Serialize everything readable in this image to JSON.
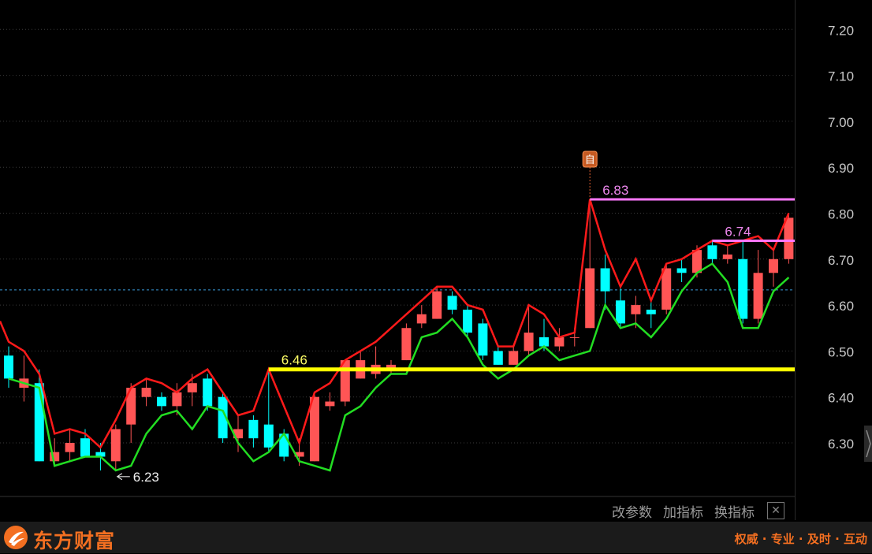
{
  "chart_data": {
    "type": "candlestick",
    "y_ticks": [
      "7.20",
      "7.10",
      "7.00",
      "6.90",
      "6.80",
      "6.70",
      "6.60",
      "6.50",
      "6.40",
      "6.30"
    ],
    "ylim": [
      6.175,
      7.255
    ],
    "grid": true,
    "last_price": 6.633,
    "candles": [
      [
        6.49,
        6.44,
        6.51,
        6.42
      ],
      [
        6.42,
        6.44,
        6.49,
        6.39
      ],
      [
        6.43,
        6.26,
        6.46,
        6.26
      ],
      [
        6.26,
        6.28,
        6.31,
        6.25
      ],
      [
        6.28,
        6.3,
        6.33,
        6.26
      ],
      [
        6.31,
        6.27,
        6.33,
        6.27
      ],
      [
        6.28,
        6.27,
        6.3,
        6.24
      ],
      [
        6.26,
        6.33,
        6.34,
        6.24
      ],
      [
        6.34,
        6.42,
        6.43,
        6.3
      ],
      [
        6.4,
        6.42,
        6.44,
        6.38
      ],
      [
        6.4,
        6.38,
        6.41,
        6.37
      ],
      [
        6.38,
        6.41,
        6.43,
        6.36
      ],
      [
        6.41,
        6.43,
        6.45,
        6.38
      ],
      [
        6.44,
        6.38,
        6.45,
        6.37
      ],
      [
        6.4,
        6.31,
        6.41,
        6.3
      ],
      [
        6.31,
        6.33,
        6.36,
        6.28
      ],
      [
        6.35,
        6.31,
        6.36,
        6.29
      ],
      [
        6.34,
        6.29,
        6.46,
        6.28
      ],
      [
        6.32,
        6.27,
        6.33,
        6.26
      ],
      [
        6.27,
        6.28,
        6.31,
        6.25
      ],
      [
        6.26,
        6.4,
        6.41,
        6.26
      ],
      [
        6.38,
        6.39,
        6.41,
        6.37
      ],
      [
        6.39,
        6.48,
        6.48,
        6.38
      ],
      [
        6.44,
        6.48,
        6.5,
        6.44
      ],
      [
        6.45,
        6.47,
        6.51,
        6.44
      ],
      [
        6.46,
        6.47,
        6.48,
        6.45
      ],
      [
        6.48,
        6.55,
        6.56,
        6.48
      ],
      [
        6.56,
        6.58,
        6.6,
        6.55
      ],
      [
        6.57,
        6.63,
        6.64,
        6.57
      ],
      [
        6.62,
        6.59,
        6.63,
        6.58
      ],
      [
        6.59,
        6.54,
        6.6,
        6.53
      ],
      [
        6.56,
        6.49,
        6.57,
        6.48
      ],
      [
        6.5,
        6.47,
        6.51,
        6.47
      ],
      [
        6.47,
        6.5,
        6.51,
        6.47
      ],
      [
        6.5,
        6.54,
        6.6,
        6.49
      ],
      [
        6.53,
        6.51,
        6.57,
        6.5
      ],
      [
        6.51,
        6.53,
        6.55,
        6.5
      ],
      [
        6.53,
        6.53,
        6.55,
        6.51
      ],
      [
        6.55,
        6.68,
        6.83,
        6.55
      ],
      [
        6.68,
        6.63,
        6.71,
        6.59
      ],
      [
        6.61,
        6.56,
        6.64,
        6.55
      ],
      [
        6.58,
        6.6,
        6.62,
        6.55
      ],
      [
        6.59,
        6.58,
        6.61,
        6.55
      ],
      [
        6.59,
        6.68,
        6.69,
        6.58
      ],
      [
        6.68,
        6.67,
        6.7,
        6.65
      ],
      [
        6.67,
        6.72,
        6.73,
        6.66
      ],
      [
        6.73,
        6.7,
        6.74,
        6.69
      ],
      [
        6.7,
        6.71,
        6.73,
        6.69
      ],
      [
        6.7,
        6.57,
        6.74,
        6.56
      ],
      [
        6.57,
        6.67,
        6.72,
        6.56
      ],
      [
        6.67,
        6.7,
        6.72,
        6.64
      ],
      [
        6.7,
        6.79,
        6.8,
        6.69
      ]
    ],
    "upper_band": [
      6.52,
      6.5,
      6.45,
      6.32,
      6.33,
      6.32,
      6.29,
      6.35,
      6.42,
      6.44,
      6.43,
      6.41,
      6.44,
      6.46,
      6.41,
      6.36,
      6.37,
      6.46,
      6.38,
      6.3,
      6.41,
      6.43,
      6.48,
      6.5,
      6.52,
      6.55,
      6.58,
      6.61,
      6.64,
      6.64,
      6.6,
      6.59,
      6.51,
      6.51,
      6.6,
      6.58,
      6.53,
      6.54,
      6.83,
      6.72,
      6.64,
      6.7,
      6.61,
      6.69,
      6.7,
      6.72,
      6.74,
      6.73,
      6.74,
      6.75,
      6.72,
      6.8
    ],
    "lower_band": [
      6.44,
      6.43,
      6.42,
      6.25,
      6.26,
      6.27,
      6.27,
      6.24,
      6.25,
      6.32,
      6.36,
      6.37,
      6.33,
      6.38,
      6.37,
      6.3,
      6.26,
      6.28,
      6.32,
      6.26,
      6.25,
      6.24,
      6.36,
      6.38,
      6.42,
      6.45,
      6.45,
      6.53,
      6.54,
      6.57,
      6.53,
      6.47,
      6.44,
      6.46,
      6.49,
      6.51,
      6.48,
      6.49,
      6.5,
      6.6,
      6.55,
      6.56,
      6.53,
      6.57,
      6.63,
      6.67,
      6.69,
      6.65,
      6.55,
      6.55,
      6.63,
      6.66
    ],
    "horizontal_lines": [
      {
        "value": 6.46,
        "label": "6.46",
        "color": "#ffff00",
        "label_color": "#ffff66",
        "start_index": 17
      },
      {
        "value": 6.83,
        "label": "6.83",
        "color": "#ff77ff",
        "label_color": "#ee88ee",
        "start_index": 38
      },
      {
        "value": 6.74,
        "label": "6.74",
        "color": "#ff77ff",
        "label_color": "#ee88ee",
        "start_index": 46
      }
    ],
    "low_annotation": {
      "label": "6.23",
      "index": 7
    },
    "marker": {
      "label": "自",
      "index": 38
    },
    "colors": {
      "up": "#ff5555",
      "down": "#00ffff",
      "upper_band": "#ff1a1a",
      "lower_band": "#22dd22",
      "grid": "#3a3a3a",
      "tick": "#c8c8c8",
      "last_price": "#3a9ad9"
    }
  },
  "toolbar": {
    "change_params": "改参数",
    "add_indicator": "加指标",
    "switch_indicator": "换指标",
    "close": "✕"
  },
  "footer": {
    "brand": "东方财富",
    "slogan": "权威 · 专业 · 及时 · 互动",
    "brand_color": "#f36f21"
  }
}
